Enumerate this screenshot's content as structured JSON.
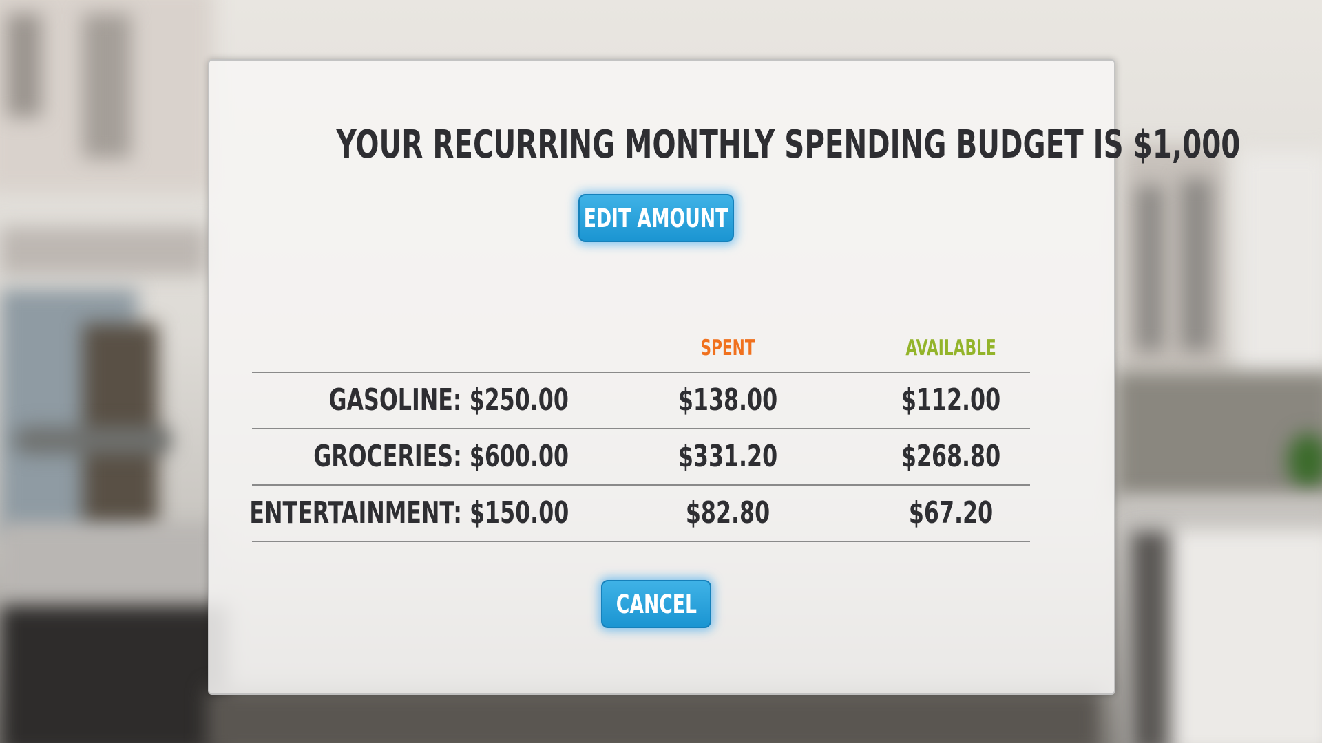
{
  "dialog": {
    "title": "YOUR RECURRING MONTHLY SPENDING BUDGET IS $1,000",
    "edit_button_label": "EDIT AMOUNT",
    "cancel_button_label": "CANCEL"
  },
  "table": {
    "headers": {
      "spent": "SPENT",
      "available": "AVAILABLE"
    },
    "rows": [
      {
        "category": "GASOLINE: $250.00",
        "spent": "$138.00",
        "available": "$112.00"
      },
      {
        "category": "GROCERIES: $600.00",
        "spent": "$331.20",
        "available": "$268.80"
      },
      {
        "category": "ENTERTAINMENT: $150.00",
        "spent": "$82.80",
        "available": "$67.20"
      }
    ]
  },
  "colors": {
    "spent_header": "#f0711e",
    "available_header": "#93b42a",
    "button": "#1f9ad6",
    "text": "#2e2e32"
  }
}
